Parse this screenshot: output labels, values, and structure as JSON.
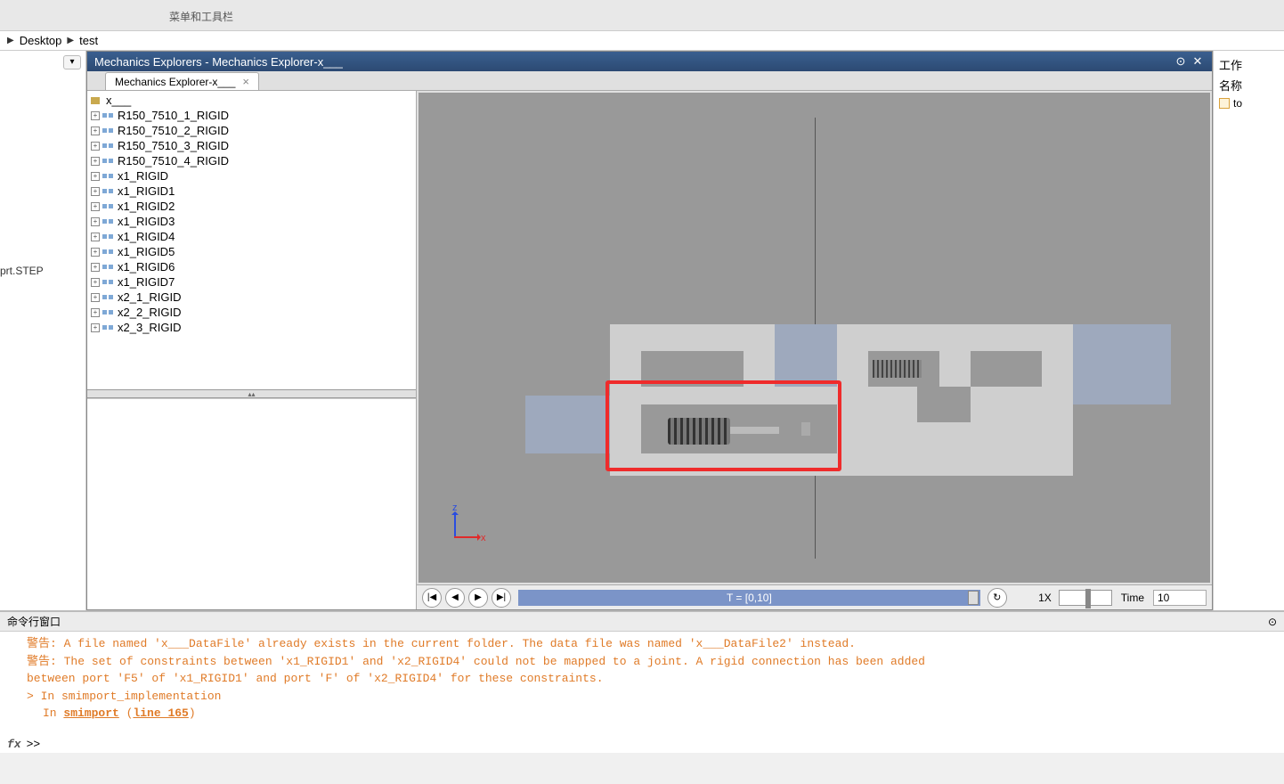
{
  "toolbar": {
    "menu_label": "菜单和工具栏"
  },
  "breadcrumb": {
    "items": [
      "Desktop",
      "test"
    ]
  },
  "left": {
    "file_label": "prt.STEP"
  },
  "explorer": {
    "title": "Mechanics Explorers - Mechanics Explorer-x___",
    "tab_label": "Mechanics Explorer-x___",
    "tree": [
      "x___",
      "R150_7510_1_RIGID",
      "R150_7510_2_RIGID",
      "R150_7510_3_RIGID",
      "R150_7510_4_RIGID",
      "x1_RIGID",
      "x1_RIGID1",
      "x1_RIGID2",
      "x1_RIGID3",
      "x1_RIGID4",
      "x1_RIGID5",
      "x1_RIGID6",
      "x1_RIGID7",
      "x2_1_RIGID",
      "x2_2_RIGID",
      "x2_3_RIGID"
    ]
  },
  "playback": {
    "slider_text": "T = [0,10]",
    "speed": "1X",
    "time_label": "Time",
    "time_value": "10"
  },
  "workspace": {
    "header": "工作",
    "name_col": "名称",
    "item": "to"
  },
  "csys": {
    "z": "z",
    "x": "x"
  },
  "cmd": {
    "title": "命令行窗口",
    "line1a": "警告:",
    "line1b": "A file named 'x___DataFile' already exists in the current folder. The data file was named 'x___DataFile2' instead.",
    "line2a": "警告:",
    "line2b": "The set of constraints between 'x1_RIGID1' and 'x2_RIGID4' could not be mapped to a joint. A rigid connection has been added",
    "line3": "between port 'F5' of 'x1_RIGID1' and port 'F' of 'x2_RIGID4' for these constraints.",
    "line4": "> In smimport_implementation",
    "line5a": "In ",
    "line5_link": "smimport",
    "line5b": " (",
    "line5_line": "line 165",
    "line5c": ")",
    "prompt": ">>"
  }
}
